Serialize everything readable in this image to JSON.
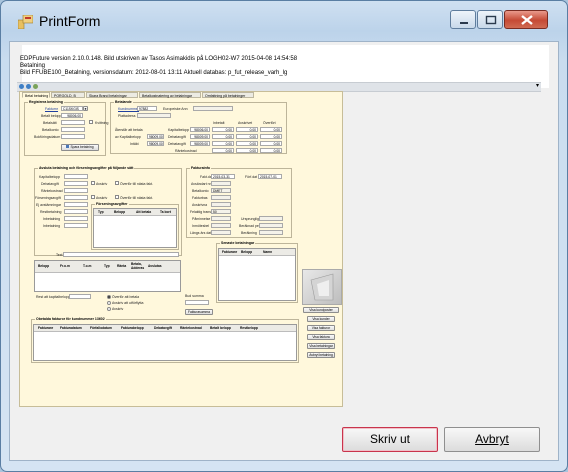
{
  "window": {
    "title": "PrintForm"
  },
  "header": {
    "line1": "EDPFuture version 2.10.0.148. Bild utskriven av Tasos Asimakidis på LOGH02-W7  2015-04-08 14:54:58",
    "line2": "Betalning",
    "line3": "Bild FFUBE100_Betalning, versionsdatum: 2012-08-01 13:11 Aktuell databas: p_fut_release_varh_lg"
  },
  "tabs": [
    "Betal betalning",
    "PORGOLD, B",
    "Skara Brand betalningar",
    "Betalkostnatering av betalningar",
    "Omfattning på betalninger"
  ],
  "reg": {
    "title": "Registrera betalning",
    "fields": [
      {
        "label": "Fakturnr",
        "value": "C11SKGIS"
      },
      {
        "label": "Betalt belopp",
        "value": "98006,00"
      },
      {
        "label": "Betalsätt",
        "value": ""
      },
      {
        "label": "Betalkonto",
        "value": ""
      },
      {
        "label": "Bokföringsdatum",
        "value": ""
      }
    ],
    "koll_label": "Kvittning",
    "spara": "Spara betalning"
  },
  "betalande": {
    "title": "Betalande",
    "kundnummer_label": "Kundnummer",
    "kundnummer": "97882",
    "kundnamn": "Europeiske Ann",
    "plattadress_label": "Plattadress",
    "col_headers": [
      "Inbetalt",
      "Avskrivet",
      "Överfört"
    ],
    "rows": [
      {
        "label": "Kapitalbelopp",
        "values": [
          "98006,00",
          "0,00",
          "0,00",
          "0,00"
        ]
      },
      {
        "label": "Debatavgift",
        "values": [
          "98009,00",
          "0,00",
          "0,00",
          "0,00"
        ]
      },
      {
        "label": "Debatavgift",
        "values": [
          "98009,00",
          "0,00",
          "0,00",
          "0,00"
        ]
      },
      {
        "label": "Räntekostnad",
        "values": [
          "",
          "0,00",
          "0,00",
          "0,00"
        ]
      }
    ],
    "side_labels": [
      "Återstår att betala",
      "av Kapitalbelopp",
      "Intäkt"
    ]
  },
  "avsluta": {
    "title": "Avsluta betalning och förseningsavgifter på följande sätt",
    "labels": [
      "Kapitalbelopp",
      "Debatavgift",
      "Räntekostnad",
      "Förseningsavgift",
      "Ej avstämningar",
      "Restbetalning",
      "Inbetalning",
      "Inbetalning"
    ],
    "avskriv": "Avskriv",
    "overfor1": "Överför till nästa fakt.",
    "avskriv2": "Avskriv",
    "overfor2": "Överför till nästa fakt.",
    "forsen_title": "Förseningsavgifter",
    "forsen_cols": [
      "Typ",
      "Belopp",
      "Att betala",
      "Ta bort"
    ]
  },
  "faktura": {
    "title": "Fakturainfo",
    "fakt_dat_label": "Fakt.dat",
    "fakt_dat": "2015-03-31",
    "fort_dat_label": "Förf.dat",
    "fort_dat": "2015-07-01",
    "labels": [
      "Avsändart nr",
      "Betalkonto",
      "Fakturbas",
      "Avskrivna",
      "Felaktig trans",
      "Påminnelse",
      "Inmötesbel",
      "Längs ärs dat"
    ],
    "values": [
      "",
      "DMET",
      "",
      "",
      "",
      "",
      "",
      ""
    ],
    "right_labels": [
      "Ursprunglig",
      "Beräknad per",
      "Beräkning"
    ],
    "belopp": "50"
  },
  "bottom": {
    "text_label": "Text",
    "belopp_cols": [
      "Belopp",
      "Fr.o.m",
      "T.o.m",
      "Typ",
      "Ränta",
      "Betala, Adderas",
      "Avslutas"
    ],
    "rest_label": "Rest att kapitalbelopp",
    "radio1": "Överför att betala",
    "radio2": "Avskriv att utförflytta",
    "radio3": "Avskriv",
    "budvolym_label": "Bud summa",
    "faktsumma": "Fakturasumma"
  },
  "senaste": {
    "title": "Senaste betalningar",
    "cols": [
      "Fakturanr",
      "Belopp",
      "Namn"
    ]
  },
  "obetalda": {
    "title": "Obetalda fakturor för kundnummer 13602",
    "cols": [
      "Fakturanr",
      "Fakturadatum",
      "Förfallodatum",
      "Fakturabelopp",
      "Debatavgift",
      "Räntekostnad",
      "Betalt belopp",
      "Restbelopp"
    ]
  },
  "side_buttons": [
    "Visa kundposter",
    "Visa kunder",
    "Visa fakturor",
    "Visa faktura",
    "Visa betalningar",
    "Avbryt betalning"
  ],
  "buttons": {
    "print": "Skriv ut",
    "cancel": "Avbryt"
  }
}
